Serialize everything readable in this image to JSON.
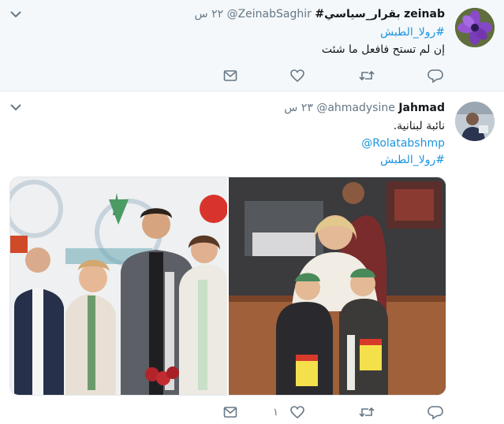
{
  "tweets": [
    {
      "name": "zeinab",
      "name_hashtag": "#بقرار_سياسي",
      "handle": "@ZeinabSaghir",
      "time": "٢٢ س",
      "lines": [
        "#رولا_الطبش",
        "إن لم تستح فافعل ما شئت"
      ],
      "actions": {
        "reply": "",
        "retweet": "",
        "like": "",
        "message": ""
      }
    },
    {
      "name": "Jahmad",
      "handle": "@ahmadysine",
      "time": "٢٣ س",
      "lines": [
        "نائبة لبنانية.",
        "@Rolatabshmp",
        "#رولا_الطبش"
      ],
      "actions": {
        "reply": "",
        "retweet": "",
        "like": "١",
        "message": ""
      }
    }
  ],
  "colors": {
    "link": "#1b95e0",
    "muted": "#657786",
    "bg_highlight": "#f5f8fa"
  },
  "icons": [
    "chevron-down-icon",
    "reply-icon",
    "retweet-icon",
    "like-icon",
    "message-icon"
  ]
}
